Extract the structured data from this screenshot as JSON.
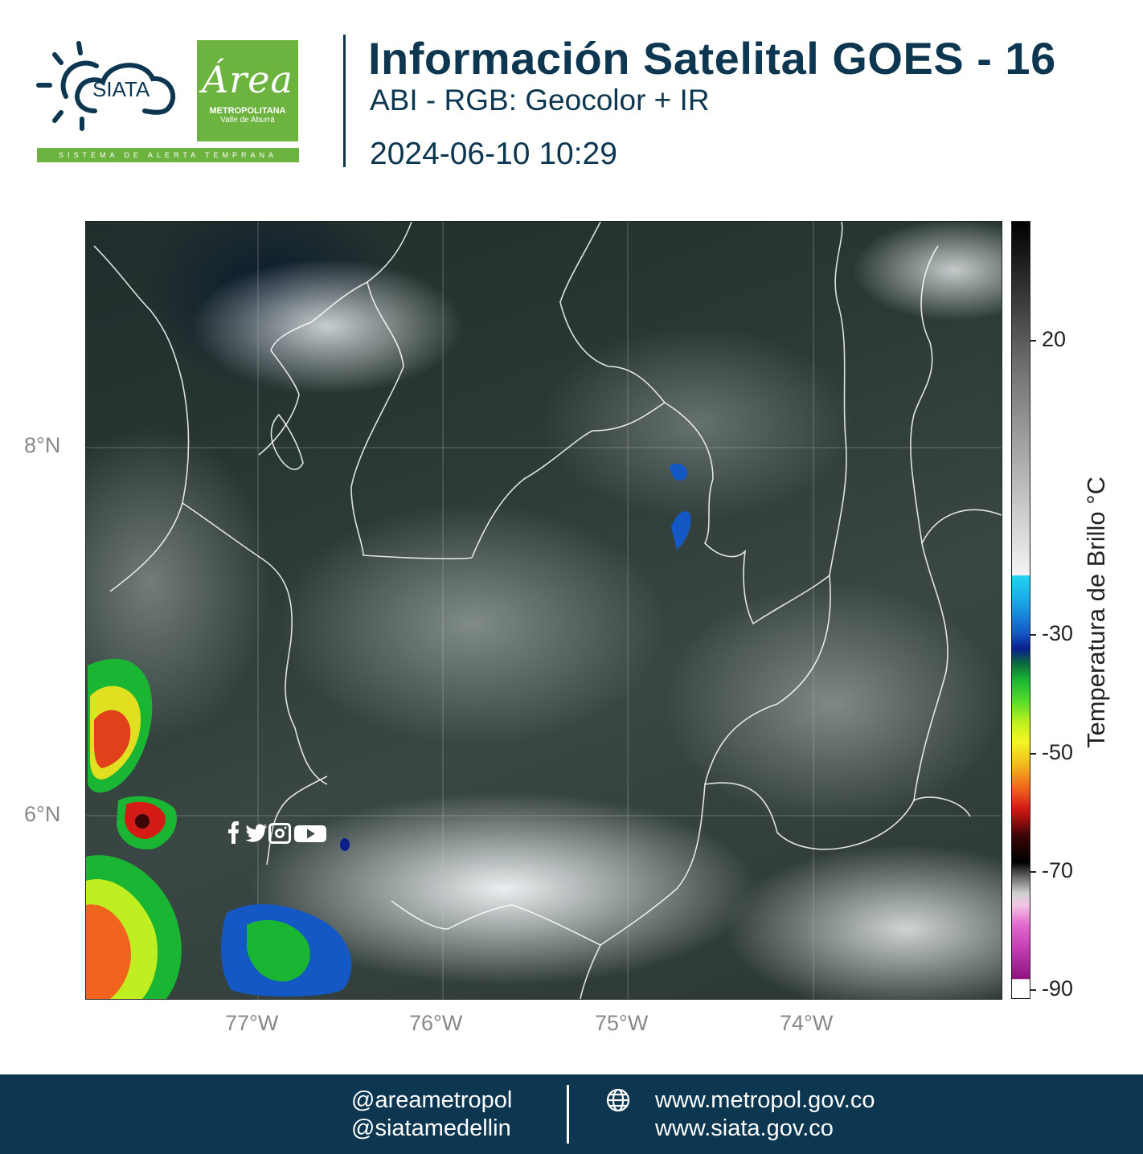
{
  "header": {
    "title": "Información Satelital GOES - 16",
    "subtitle": "ABI - RGB: Geocolor + IR",
    "timestamp": "2024-06-10 10:29"
  },
  "logos": {
    "siata_text": "SIATA",
    "siata_tagline": "SISTEMA DE ALERTA TEMPRANA",
    "area_script": "Área",
    "area_line1": "METROPOLITANA",
    "area_line2": "Valle de Aburrá",
    "brand_green": "#6cb33f",
    "brand_navy": "#0d3650"
  },
  "map": {
    "lat_labels": [
      "8°N",
      "6°N"
    ],
    "lon_labels": [
      "77°W",
      "76°W",
      "75°W",
      "74°W"
    ]
  },
  "colorbar": {
    "title": "Temperatura de Brillo °C",
    "labels": [
      "20",
      "-30",
      "-50",
      "-70",
      "-90"
    ]
  },
  "footer": {
    "handle1": "@areametropol",
    "handle2": "@siatamedellin",
    "site1": "www.metropol.gov.co",
    "site2": "www.siata.gov.co",
    "social_icons": [
      "facebook-icon",
      "twitter-icon",
      "instagram-icon",
      "youtube-icon"
    ],
    "web_icon": "globe-icon"
  }
}
